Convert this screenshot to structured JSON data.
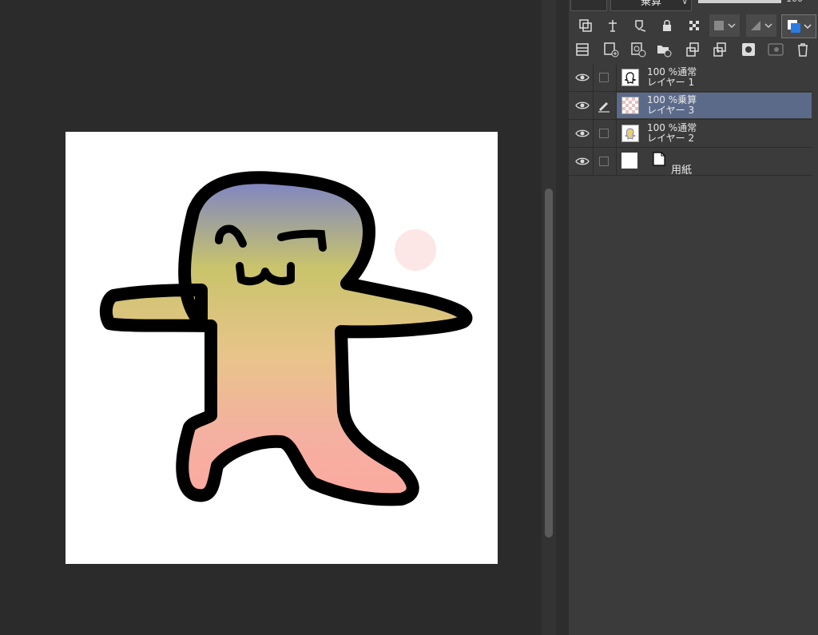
{
  "colors": {
    "workspace_bg": "#2b2b2b",
    "panel_bg": "#3b3b3b",
    "selected_layer": "#5c6a8a",
    "paper": "#ffffff"
  },
  "layer_properties": {
    "blend_mode": "乗算",
    "opacity_value": "100"
  },
  "toolbar_row1_icons": [
    "copy-layer-icon",
    "reference-layer-icon",
    "draft-layer-icon",
    "lock-icon",
    "lock-transparency-icon",
    "mask-icon",
    "ruler-icon",
    "layer-color-icon"
  ],
  "toolbar_row2_icons": [
    "layer-property-icon",
    "new-raster-layer-icon",
    "new-vector-layer-icon",
    "new-folder-icon",
    "transfer-down-icon",
    "merge-down-icon",
    "layer-mask-icon",
    "apply-mask-icon",
    "delete-layer-icon"
  ],
  "layers": [
    {
      "opacity": "100 %",
      "blend": "通常",
      "name": "レイヤー 1",
      "selected": false
    },
    {
      "opacity": "100 %",
      "blend": "乗算",
      "name": "レイヤー 3",
      "selected": true
    },
    {
      "opacity": "100 %",
      "blend": "通常",
      "name": "レイヤー 2",
      "selected": false
    }
  ],
  "paper_layer": {
    "name": "用紙"
  }
}
